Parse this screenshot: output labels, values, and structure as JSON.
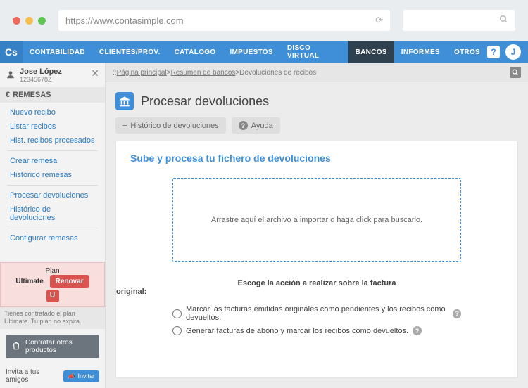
{
  "chrome": {
    "url": "https://www.contasimple.com"
  },
  "nav": {
    "logo": "Cs",
    "items": [
      "CONTABILIDAD",
      "CLIENTES/PROV.",
      "CATÁLOGO",
      "IMPUESTOS",
      "DISCO VIRTUAL",
      "BANCOS",
      "INFORMES",
      "OTROS"
    ],
    "active": "BANCOS",
    "avatar": "J"
  },
  "user": {
    "name": "Jose López",
    "id": "12345678Z"
  },
  "sidebar": {
    "section": "REMESAS",
    "links": [
      "Nuevo recibo",
      "Listar recibos",
      "Hist. recibos procesados",
      "Crear remesa",
      "Histórico remesas",
      "Procesar devoluciones",
      "Histórico de devoluciones",
      "Configurar remesas"
    ]
  },
  "plan": {
    "label_plan": "Plan",
    "label_ultimate": "Ultimate",
    "badge": "U",
    "renew": "Renovar",
    "note": "Tienes contratado el plan Ultimate. Tu plan no expira."
  },
  "contract_btn": "Contratar otros productos",
  "invite": {
    "text": "Invita a tus amigos",
    "btn": "Invitar"
  },
  "crumbs": {
    "home": "Página principal",
    "sep": ">",
    "resume": "Resumen de bancos",
    "current": "Devoluciones de recibos"
  },
  "title": "Procesar devoluciones",
  "toolbar": {
    "hist": "Histórico de devoluciones",
    "help": "Ayuda"
  },
  "panel": {
    "heading": "Sube y procesa tu fichero de devoluciones",
    "dropzone": "Arrastre aquí el archivo a importar o haga click para buscarlo.",
    "action_head": "Escoge la acción a realizar sobre la factura",
    "action_head2": "original:",
    "opt1": "Marcar las facturas emitidas originales como pendientes y los recibos como devueltos.",
    "opt2": "Generar facturas de abono y marcar los recibos como devueltos."
  }
}
